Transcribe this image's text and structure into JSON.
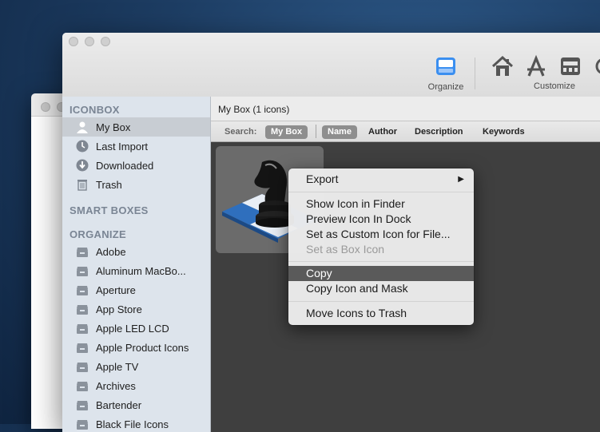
{
  "toolbar": {
    "organize_label": "Organize",
    "customize_label": "Customize"
  },
  "sidebar": {
    "iconbox_header": "ICONBOX",
    "iconbox_items": [
      {
        "label": "My Box",
        "icon": "user-icon"
      },
      {
        "label": "Last Import",
        "icon": "clock-icon"
      },
      {
        "label": "Downloaded",
        "icon": "download-icon"
      },
      {
        "label": "Trash",
        "icon": "trash-icon"
      }
    ],
    "smart_header": "SMART BOXES",
    "organize_header": "ORGANIZE",
    "organize_items": [
      {
        "label": "Adobe"
      },
      {
        "label": "Aluminum MacBo..."
      },
      {
        "label": "Aperture"
      },
      {
        "label": "App Store"
      },
      {
        "label": "Apple LED LCD"
      },
      {
        "label": "Apple Product Icons"
      },
      {
        "label": "Apple TV"
      },
      {
        "label": "Archives"
      },
      {
        "label": "Bartender"
      },
      {
        "label": "Black File Icons"
      }
    ]
  },
  "content": {
    "path_title": "My Box (1 icons)",
    "search_label": "Search:",
    "scopes": [
      "My Box",
      "Name",
      "Author",
      "Description",
      "Keywords"
    ]
  },
  "context_menu": {
    "items": [
      {
        "label": "Export",
        "submenu": true
      },
      {
        "label": "Show Icon in Finder"
      },
      {
        "label": "Preview Icon In Dock"
      },
      {
        "label": "Set as Custom Icon for File..."
      },
      {
        "label": "Set as Box Icon",
        "disabled": true
      },
      {
        "label": "Copy",
        "highlighted": true
      },
      {
        "label": "Copy Icon and Mask"
      },
      {
        "label": "Move Icons to Trash"
      }
    ]
  },
  "colors": {
    "accent": "#3b8ff0",
    "sidebar_bg": "#dde4ec",
    "content_bg": "#3f3f3f"
  }
}
